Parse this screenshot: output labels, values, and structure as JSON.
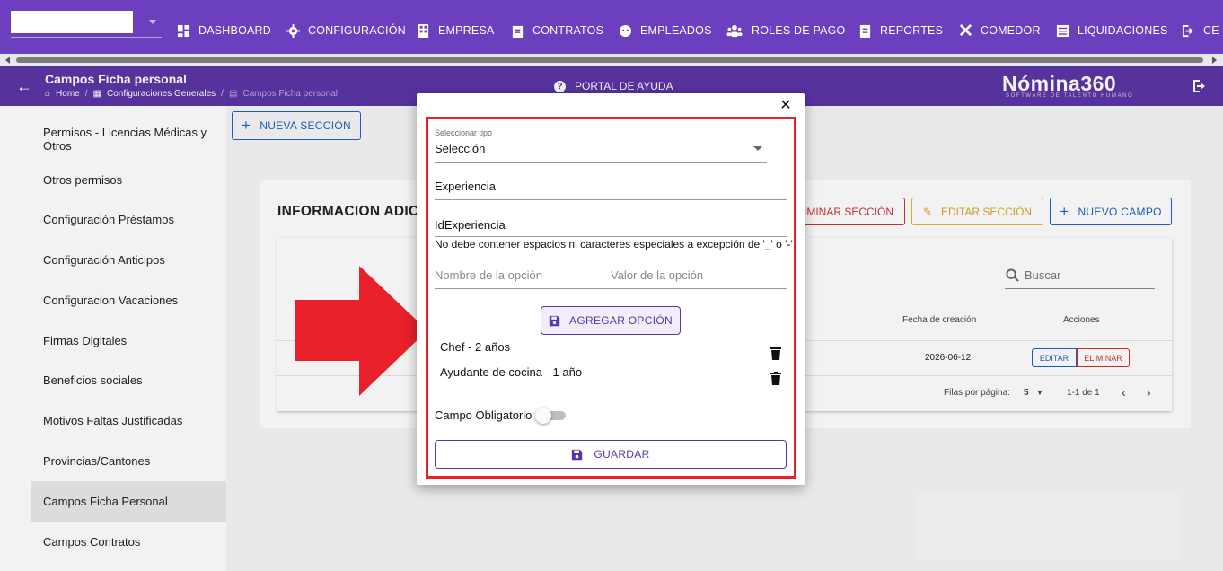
{
  "topnav": {
    "items": [
      {
        "label": "DASHBOARD",
        "icon": "dashboard-icon"
      },
      {
        "label": "CONFIGURACIÓN",
        "icon": "gear-icon"
      },
      {
        "label": "EMPRESA",
        "icon": "building-icon"
      },
      {
        "label": "CONTRATOS",
        "icon": "clipboard-icon"
      },
      {
        "label": "EMPLEADOS",
        "icon": "face-icon"
      },
      {
        "label": "ROLES DE PAGO",
        "icon": "people-icon"
      },
      {
        "label": "REPORTES",
        "icon": "report-icon"
      },
      {
        "label": "COMEDOR",
        "icon": "utensils-icon"
      },
      {
        "label": "LIQUIDACIONES",
        "icon": "list-icon"
      },
      {
        "label": "CE",
        "icon": "exit-icon"
      }
    ]
  },
  "subheader": {
    "title": "Campos Ficha personal",
    "breadcrumbs": [
      "Home",
      "Configuraciones Generales",
      "Campos Ficha personal"
    ],
    "help_label": "PORTAL DE AYUDA",
    "brand": "Nómina360",
    "brand_tagline": "SOFTWARE DE TALENTO HUMANO"
  },
  "sidebar": {
    "items": [
      "Permisos - Licencias Médicas y Otros",
      "Otros permisos",
      "Configuración Préstamos",
      "Configuración Anticipos",
      "Configuracion Vacaciones",
      "Firmas Digitales",
      "Beneficios sociales",
      "Motivos Faltas Justificadas",
      "Provincias/Cantones",
      "Campos Ficha Personal",
      "Campos Contratos"
    ],
    "active": "Campos Ficha Personal"
  },
  "main": {
    "new_section": "NUEVA SECCIÓN",
    "section_title": "INFORMACION ADIC",
    "delete_section": "LIMINAR SECCIÓN",
    "edit_section": "EDITAR SECCIÓN",
    "new_field": "NUEVO CAMPO",
    "search_placeholder": "Buscar",
    "col_created": "Fecha de creación",
    "col_actions": "Acciones",
    "row_date": "2026-06-12",
    "edit_btn": "EDITAR",
    "delete_btn": "ELIMINAR",
    "rows_per_page_label": "Filas por página:",
    "rows_per_page": "5",
    "range": "1-1 de 1"
  },
  "modal": {
    "type_label": "Seleccionar tipo",
    "type_value": "Selección",
    "name_value": "Experiencia",
    "id_value": "IdExperiencia",
    "id_helper": "No debe contener espacios ni caracteres especiales a excepción de '_' o '-'",
    "option_name_placeholder": "Nombre de la opción",
    "option_value_placeholder": "Valor de la opción",
    "add_option": "AGREGAR OPCIÓN",
    "options": [
      "Chef - 2 años",
      "Ayudante de cocina - 1 año"
    ],
    "required_label": "Campo Obligatorio",
    "required": false,
    "save": "GUARDAR"
  },
  "colors": {
    "nav": "#6b3fbe",
    "subheader": "#5b35a6",
    "highlight": "#e8202a",
    "primary": "#1e63c6",
    "danger": "#d32f2f",
    "warning": "#e4b53a"
  }
}
